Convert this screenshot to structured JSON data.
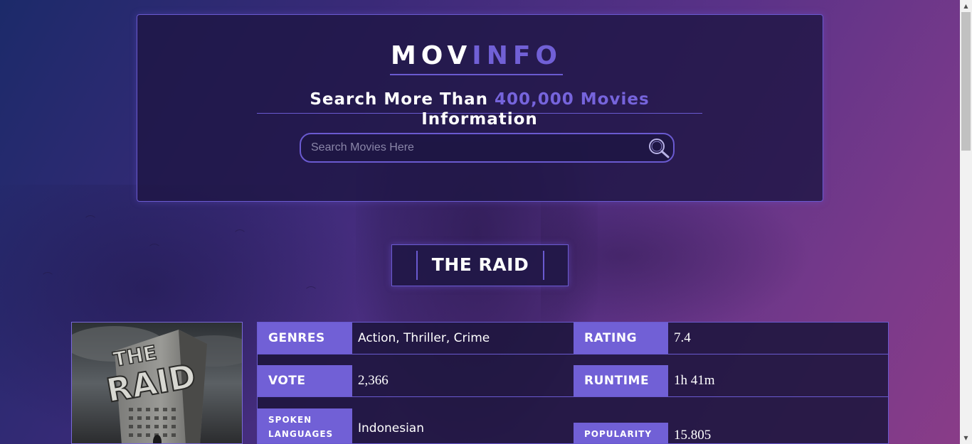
{
  "header": {
    "logo_part1": "MOV",
    "logo_part2": "INFO",
    "tagline_before": "Search More Than",
    "tagline_highlight": "400,000 Movies",
    "tagline_after": "Information"
  },
  "search": {
    "placeholder": "Search Movies Here",
    "value": "",
    "icon": "search-icon"
  },
  "movie": {
    "title": "THE RAID",
    "poster_text_line1": "THE",
    "poster_text_line2": "RAID",
    "details": {
      "genres_label": "GENRES",
      "genres_value": "Action, Thriller, Crime",
      "rating_label": "RATING",
      "rating_value": "7.4",
      "vote_label": "VOTE",
      "vote_value": "2,366",
      "runtime_label": "RUNTIME",
      "runtime_value": "1h 41m",
      "spoken_label_line1": "SPOKEN",
      "spoken_label_line2": "LANGUAGES",
      "spoken_value": "Indonesian",
      "popularity_label": "POPULARITY",
      "popularity_value": "15.805"
    }
  },
  "colors": {
    "accent": "#7160d6",
    "panel": "#1e1644",
    "border": "#6a5ad0"
  }
}
